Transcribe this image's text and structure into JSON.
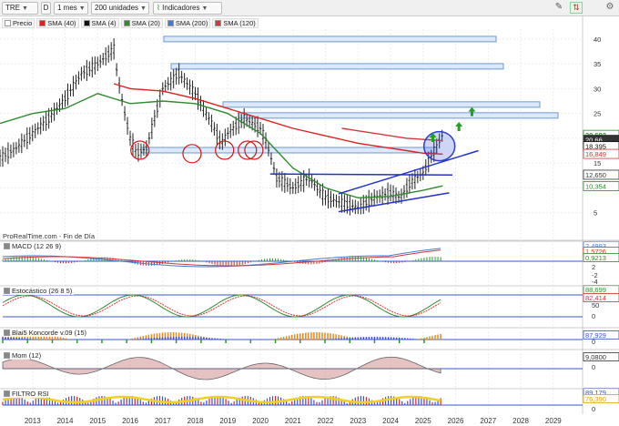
{
  "toolbar": {
    "symbol": "TRE",
    "d_button": "D",
    "timeframe": "1 mes",
    "units": "200 unidades",
    "indicators": "Indicadores"
  },
  "legend": [
    {
      "label": "Precio",
      "color": "#222222"
    },
    {
      "label": "SMA (40)",
      "color": "#e02020"
    },
    {
      "label": "SMA (4)",
      "color": "#111111"
    },
    {
      "label": "SMA (20)",
      "color": "#2e8b2e"
    },
    {
      "label": "SMA (200)",
      "color": "#3a7fd5"
    },
    {
      "label": "SMA (120)",
      "color": "#d23a3a"
    }
  ],
  "source_note": "ProRealTime.com - Fin de Día",
  "price_tags": [
    {
      "value": "20,692",
      "price": 20.692,
      "color": "#2e8b2e",
      "bold": true
    },
    {
      "value": "20,66",
      "price": 19.7,
      "color": "#ffffff",
      "bg": "#333333"
    },
    {
      "value": "18,395",
      "price": 18.395,
      "color": "#111111"
    },
    {
      "value": "16,849",
      "price": 16.849,
      "color": "#d23a3a"
    },
    {
      "value": "12,650",
      "price": 12.65,
      "color": "#333333"
    },
    {
      "value": "10,354",
      "price": 10.354,
      "color": "#2e8b2e"
    }
  ],
  "chart_data": {
    "type": "line",
    "title": "",
    "x_ticks": [
      "2013",
      "2014",
      "2015",
      "2016",
      "2017",
      "2018",
      "2019",
      "2020",
      "2021",
      "2022",
      "2023",
      "2024",
      "2025",
      "2026",
      "2027",
      "2028",
      "2029"
    ],
    "y_ticks": [
      5,
      10,
      15,
      20,
      25,
      30,
      35,
      40
    ],
    "ylim": [
      2,
      42
    ],
    "xlim": [
      2012.0,
      2029.9
    ],
    "grid": true,
    "series": [
      {
        "name": "Precio",
        "color": "#222222",
        "x": [
          2012.0,
          2012.5,
          2013.0,
          2013.5,
          2014.0,
          2014.5,
          2015.0,
          2015.5,
          2015.6,
          2015.8,
          2016.0,
          2016.2,
          2016.5,
          2017.0,
          2017.5,
          2018.0,
          2018.5,
          2018.8,
          2019.0,
          2019.5,
          2020.0,
          2020.2,
          2020.5,
          2021.0,
          2021.5,
          2022.0,
          2022.5,
          2023.0,
          2023.5,
          2024.0,
          2024.3,
          2024.6,
          2025.0,
          2025.3,
          2025.6
        ],
        "y": [
          16,
          18,
          21,
          24,
          28,
          33,
          35,
          38,
          33,
          26,
          20,
          17,
          18,
          30,
          33,
          29,
          23,
          19,
          21,
          24,
          22,
          19,
          12,
          10,
          12,
          8,
          7,
          6,
          8,
          9,
          8,
          11,
          13,
          17,
          20.7
        ]
      },
      {
        "name": "SMA (20)",
        "color": "#2e8b2e",
        "x": [
          2012.0,
          2013.0,
          2014.0,
          2015.0,
          2016.0,
          2017.0,
          2018.0,
          2019.0,
          2020.0,
          2021.0,
          2022.0,
          2023.0,
          2024.0,
          2025.0,
          2025.6
        ],
        "y": [
          23,
          25,
          26,
          29,
          27,
          27.5,
          27,
          25,
          21,
          14,
          10,
          8,
          8.3,
          9.5,
          10.4
        ]
      },
      {
        "name": "SMA (40)",
        "color": "#e02020",
        "x": [
          2015.5,
          2016.0,
          2017.0,
          2018.0,
          2019.0,
          2020.0,
          2021.0,
          2022.0,
          2023.0,
          2024.0,
          2024.5,
          2025.0,
          2025.6
        ],
        "y": [
          31,
          30,
          29.5,
          28,
          26,
          24,
          22,
          20.5,
          19,
          18,
          17.5,
          17,
          16.8
        ]
      },
      {
        "name": "SMA (120)",
        "color": "#d23a3a",
        "x": [
          2022.5,
          2023.5,
          2024.5,
          2025.6
        ],
        "y": [
          22,
          21,
          20,
          19.5
        ]
      }
    ]
  },
  "panels": [
    {
      "id": "macd",
      "title": "MACD (12 26 9)",
      "tags": [
        "2,4993",
        "1,5726",
        "0,9213"
      ],
      "ticks": [
        "2",
        "-2",
        "-4"
      ]
    },
    {
      "id": "stoch",
      "title": "Estocástico (26 8 5)",
      "tags": [
        "88,699",
        "82,414"
      ],
      "ticks": [
        "50",
        "0"
      ]
    },
    {
      "id": "blai5",
      "title": "Blai5 Koncorde v.09 (15)",
      "tags": [
        "87,929"
      ],
      "ticks": [
        "0"
      ]
    },
    {
      "id": "mom",
      "title": "Mom (12)",
      "tags": [
        "9,0800"
      ],
      "ticks": [
        "0"
      ]
    },
    {
      "id": "filtro",
      "title": "FILTRO RSI",
      "tags": [
        "89,179",
        "76,390"
      ],
      "ticks": [
        "0"
      ]
    }
  ]
}
